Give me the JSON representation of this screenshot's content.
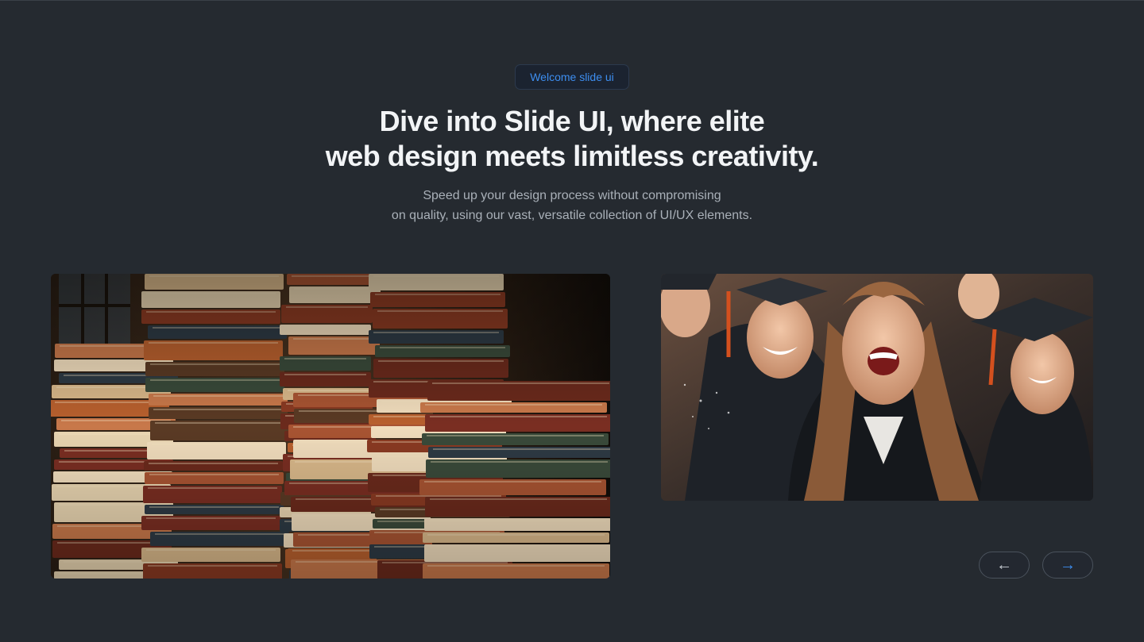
{
  "badge": {
    "label": "Welcome slide ui"
  },
  "hero": {
    "title_line1": "Dive into Slide UI, where elite",
    "title_line2": "web design meets limitless creativity.",
    "subtitle_line1": "Speed up your design process without compromising",
    "subtitle_line2": "on quality, using our vast, versatile collection of UI/UX elements."
  },
  "slides": [
    {
      "name": "stacked-books-image"
    },
    {
      "name": "graduates-celebrating-image"
    }
  ],
  "carousel": {
    "prev_icon": "arrow-left-icon",
    "next_icon": "arrow-right-icon",
    "prev_glyph": "←",
    "next_glyph": "→"
  },
  "colors": {
    "background": "#252a30",
    "accent": "#3d8ef0",
    "heading": "#f2f4f6",
    "body_text": "#a9b0b8"
  }
}
